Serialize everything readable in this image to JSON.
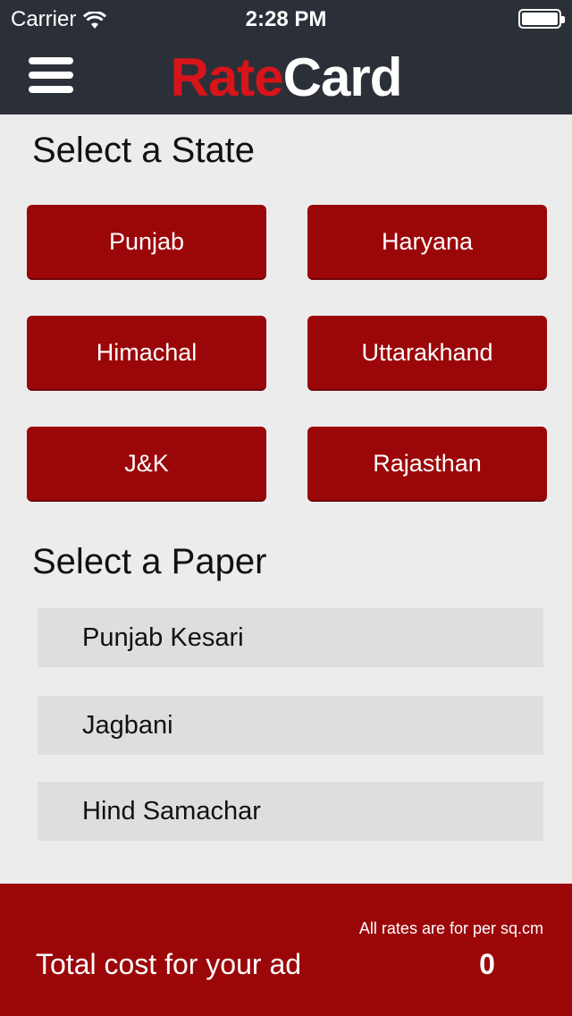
{
  "status_bar": {
    "carrier": "Carrier",
    "time": "2:28 PM",
    "wifi_icon": "wifi-icon",
    "battery_icon": "battery-icon"
  },
  "header": {
    "menu_icon": "hamburger-menu-icon",
    "logo_part1": "Rate",
    "logo_part2": "Card",
    "logo_color_1": "#d7141a",
    "logo_color_2": "#ffffff",
    "background": "#2b3038"
  },
  "state_section": {
    "title": "Select a State",
    "states": [
      "Punjab",
      "Haryana",
      "Himachal",
      "Uttarakhand",
      "J&K",
      "Rajasthan"
    ]
  },
  "paper_section": {
    "title": "Select a Paper",
    "papers": [
      "Punjab Kesari",
      "Jagbani",
      "Hind Samachar"
    ]
  },
  "footer": {
    "note": "All rates are for per sq.cm",
    "label": "Total cost for your ad",
    "total": "0"
  },
  "colors": {
    "accent": "#9b0709",
    "page_background": "#ececec",
    "list_item_background": "#dedede"
  }
}
